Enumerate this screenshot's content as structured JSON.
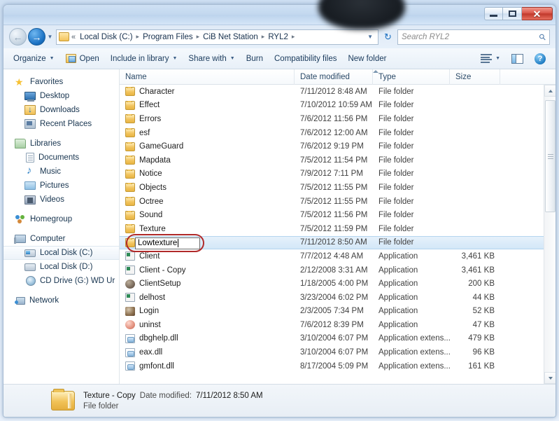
{
  "window": {
    "controls": {
      "minimize": "–",
      "maximize": "□",
      "close": "✕"
    }
  },
  "address_bar": {
    "back_label": "←",
    "forward_label": "→",
    "history_caret": "▼",
    "chevrons": "«",
    "breadcrumbs": [
      "Local Disk (C:)",
      "Program Files",
      "CiB Net Station",
      "RYL2"
    ],
    "separator": "▸",
    "dropdown_caret": "▼",
    "refresh_label": "↻",
    "search_placeholder": "Search RYL2",
    "search_value": "",
    "search_icon": "search-icon"
  },
  "command_bar": {
    "items": [
      {
        "label": "Organize",
        "has_caret": true,
        "icon": ""
      },
      {
        "label": "Open",
        "has_caret": false,
        "icon": "open-folder-icon"
      },
      {
        "label": "Include in library",
        "has_caret": true,
        "icon": ""
      },
      {
        "label": "Share with",
        "has_caret": true,
        "icon": ""
      },
      {
        "label": "Burn",
        "has_caret": false,
        "icon": ""
      },
      {
        "label": "Compatibility files",
        "has_caret": false,
        "icon": ""
      },
      {
        "label": "New folder",
        "has_caret": false,
        "icon": ""
      }
    ],
    "view_caret": "▼",
    "help_label": "?"
  },
  "nav_pane": {
    "groups": [
      {
        "header": {
          "label": "Favorites",
          "icon": "star-icon"
        },
        "items": [
          {
            "label": "Desktop",
            "icon": "desktop-icon"
          },
          {
            "label": "Downloads",
            "icon": "downloads-icon"
          },
          {
            "label": "Recent Places",
            "icon": "recent-places-icon"
          }
        ]
      },
      {
        "header": {
          "label": "Libraries",
          "icon": "libraries-icon"
        },
        "items": [
          {
            "label": "Documents",
            "icon": "documents-icon"
          },
          {
            "label": "Music",
            "icon": "music-icon"
          },
          {
            "label": "Pictures",
            "icon": "pictures-icon"
          },
          {
            "label": "Videos",
            "icon": "videos-icon"
          }
        ]
      },
      {
        "header": {
          "label": "Homegroup",
          "icon": "homegroup-icon"
        },
        "items": []
      },
      {
        "header": {
          "label": "Computer",
          "icon": "computer-icon"
        },
        "items": [
          {
            "label": "Local Disk (C:)",
            "icon": "system-drive-icon",
            "selected": true
          },
          {
            "label": "Local Disk (D:)",
            "icon": "drive-icon"
          },
          {
            "label": "CD Drive (G:) WD Ur",
            "icon": "cd-drive-icon"
          }
        ]
      },
      {
        "header": {
          "label": "Network",
          "icon": "network-icon"
        },
        "items": []
      }
    ]
  },
  "file_list": {
    "columns": [
      "Name",
      "Date modified",
      "Type",
      "Size"
    ],
    "sort_indicator": "ascending",
    "rows": [
      {
        "name": "Character",
        "date": "7/11/2012 8:48 AM",
        "type": "File folder",
        "size": "",
        "icon": "folder-icon"
      },
      {
        "name": "Effect",
        "date": "7/10/2012 10:59 AM",
        "type": "File folder",
        "size": "",
        "icon": "folder-icon"
      },
      {
        "name": "Errors",
        "date": "7/6/2012 11:56 PM",
        "type": "File folder",
        "size": "",
        "icon": "folder-icon"
      },
      {
        "name": "esf",
        "date": "7/6/2012 12:00 AM",
        "type": "File folder",
        "size": "",
        "icon": "folder-icon"
      },
      {
        "name": "GameGuard",
        "date": "7/6/2012 9:19 PM",
        "type": "File folder",
        "size": "",
        "icon": "folder-icon"
      },
      {
        "name": "Mapdata",
        "date": "7/5/2012 11:54 PM",
        "type": "File folder",
        "size": "",
        "icon": "folder-icon"
      },
      {
        "name": "Notice",
        "date": "7/9/2012 7:11 PM",
        "type": "File folder",
        "size": "",
        "icon": "folder-icon"
      },
      {
        "name": "Objects",
        "date": "7/5/2012 11:55 PM",
        "type": "File folder",
        "size": "",
        "icon": "folder-icon"
      },
      {
        "name": "Octree",
        "date": "7/5/2012 11:55 PM",
        "type": "File folder",
        "size": "",
        "icon": "folder-icon"
      },
      {
        "name": "Sound",
        "date": "7/5/2012 11:56 PM",
        "type": "File folder",
        "size": "",
        "icon": "folder-icon"
      },
      {
        "name": "Texture",
        "date": "7/5/2012 11:59 PM",
        "type": "File folder",
        "size": "",
        "icon": "folder-icon"
      },
      {
        "name": "",
        "date": "7/11/2012 8:50 AM",
        "type": "File folder",
        "size": "",
        "icon": "folder-icon",
        "renaming": true
      },
      {
        "name": "Client",
        "date": "7/7/2012 4:48 AM",
        "type": "Application",
        "size": "3,461 KB",
        "icon": "application-icon"
      },
      {
        "name": "Client - Copy",
        "date": "2/12/2008 3:31 AM",
        "type": "Application",
        "size": "3,461 KB",
        "icon": "application-icon"
      },
      {
        "name": "ClientSetup",
        "date": "1/18/2005 4:00 PM",
        "type": "Application",
        "size": "200 KB",
        "icon": "setup-icon"
      },
      {
        "name": "delhost",
        "date": "3/23/2004 6:02 PM",
        "type": "Application",
        "size": "44 KB",
        "icon": "application-icon"
      },
      {
        "name": "Login",
        "date": "2/3/2005 7:34 PM",
        "type": "Application",
        "size": "52 KB",
        "icon": "login-icon"
      },
      {
        "name": "uninst",
        "date": "7/6/2012 8:39 PM",
        "type": "Application",
        "size": "47 KB",
        "icon": "uninstall-icon"
      },
      {
        "name": "dbghelp.dll",
        "date": "3/10/2004 6:07 PM",
        "type": "Application extens...",
        "size": "479 KB",
        "icon": "dll-icon"
      },
      {
        "name": "eax.dll",
        "date": "3/10/2004 6:07 PM",
        "type": "Application extens...",
        "size": "96 KB",
        "icon": "dll-icon"
      },
      {
        "name": "gmfont.dll",
        "date": "8/17/2004 5:09 PM",
        "type": "Application extens...",
        "size": "161 KB",
        "icon": "dll-icon"
      }
    ],
    "rename_value": "Lowtexture"
  },
  "details_pane": {
    "name": "Texture - Copy",
    "date_label": "Date modified:",
    "date_value": "7/11/2012 8:50 AM",
    "type": "File folder"
  },
  "colors": {
    "selection_blue": "#d3e7f8",
    "annotation_red": "#b02a2a",
    "folder_yellow": "#f2c45f",
    "close_red": "#c0392c"
  }
}
